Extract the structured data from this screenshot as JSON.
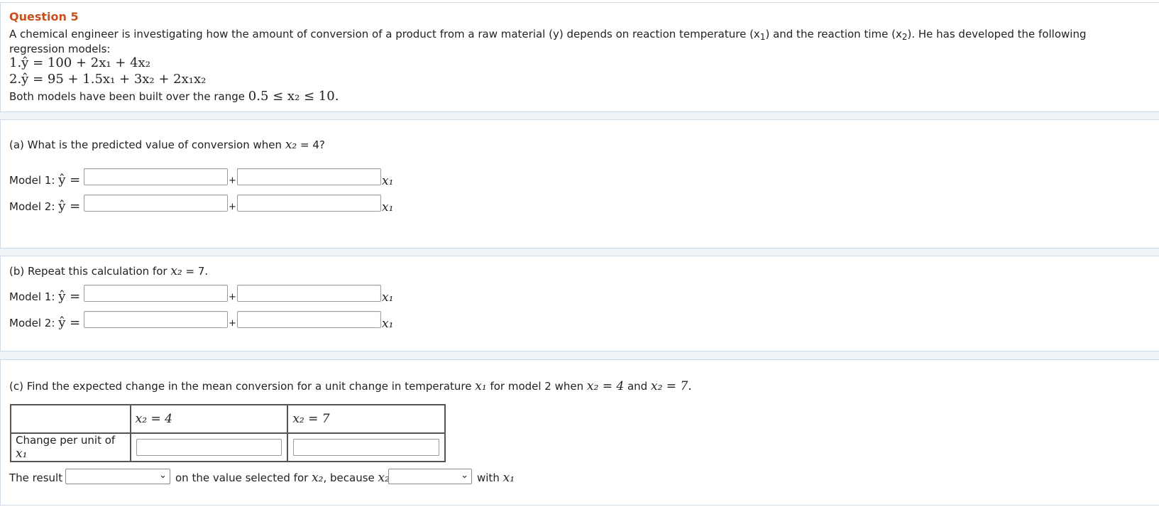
{
  "question": {
    "title": "Question 5",
    "intro_line1": "A chemical engineer is investigating how the amount of conversion of a product from a raw material (y) depends on reaction temperature (x",
    "intro_line1_mid": ") and the reaction time (x",
    "intro_line1_end": "). He has developed the following",
    "intro_line2": "regression models:",
    "model1": "1.ŷ = 100 + 2x₁ + 4x₂",
    "model2": "2.ŷ = 95 + 1.5x₁ + 3x₂ + 2x₁x₂",
    "range_prefix": "Both models have been built over the range",
    "range_math": "0.5 ≤ x₂ ≤ 10."
  },
  "part_a": {
    "prompt": "(a) What is the predicted value of conversion when",
    "prompt_var": "x₂",
    "prompt_end": "= 4?",
    "model1_label": "Model 1:",
    "model2_label": "Model 2:",
    "yhat": "ŷ =",
    "plus": "+",
    "x1": "x₁"
  },
  "part_b": {
    "prompt": "(b) Repeat this calculation for",
    "prompt_var": "x₂",
    "prompt_end": "= 7.",
    "model1_label": "Model 1:",
    "model2_label": "Model 2:",
    "yhat": "ŷ =",
    "plus": "+",
    "x1": "x₁"
  },
  "part_c": {
    "prompt": "(c) Find the expected change in the mean conversion for a unit change in temperature",
    "prompt_x1": "x₁",
    "prompt_mid": "for model 2 when",
    "prompt_eq4": "x₂ = 4",
    "prompt_and": "and",
    "prompt_eq7": "x₂ = 7.",
    "table_col1": "x₂ = 4",
    "table_col2": "x₂ = 7",
    "table_row_label": "Change per unit of",
    "table_row_var": "x₁",
    "result_prefix": "The result",
    "result_mid": "on the value selected for",
    "result_var": "x₂",
    "result_because": ", because",
    "result_var2": "x₂",
    "result_end": "with",
    "result_var3": "x₁",
    "dropdown_icon": "chevron-down-icon"
  }
}
